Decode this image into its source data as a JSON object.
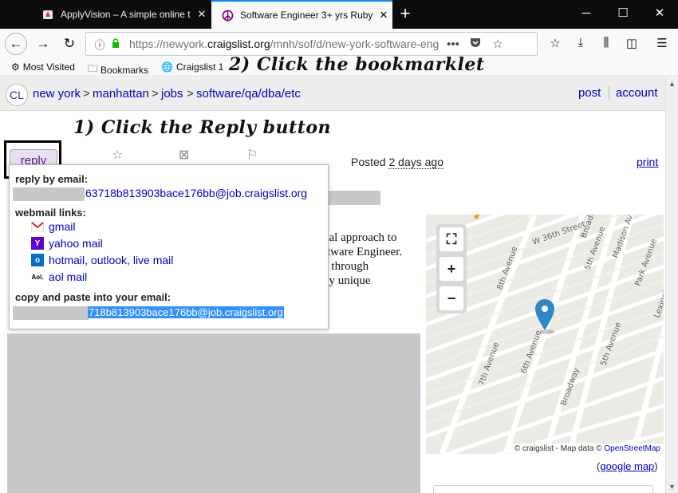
{
  "browser": {
    "tabs": [
      {
        "title": "ApplyVision – A simple online t",
        "icon": "applyvision-icon",
        "active": false
      },
      {
        "title": "Software Engineer 3+ yrs Ruby",
        "icon": "peace-icon",
        "active": true
      }
    ],
    "url_prefix": "https://newyork.",
    "url_domain": "craigslist.org",
    "url_path": "/mnh/sof/d/new-york-software-eng",
    "bookmarks": [
      {
        "label": "Most Visited",
        "icon": "gear-icon"
      },
      {
        "label": "Bookmarks",
        "icon": "folder-icon"
      },
      {
        "label": "Craigslist 1",
        "icon": "globe-icon"
      }
    ]
  },
  "annotations": {
    "step1": "1) Click the Reply button",
    "step2": "2) Click the bookmarklet"
  },
  "breadcrumbs": {
    "logo": "CL",
    "items": [
      "new york",
      "manhattan",
      "jobs",
      "software/qa/dba/etc"
    ],
    "separator": ">",
    "post": "post",
    "account": "account"
  },
  "posting": {
    "reply_label": "reply",
    "posted_prefix": "Posted",
    "posted_ago": "2 days ago",
    "print": "print",
    "body_lines": [
      "nal approach to",
      "ftware Engineer.",
      "e through",
      "by unique"
    ]
  },
  "reply_popup": {
    "reply_by_email_label": "reply by email:",
    "email_visible": "63718b813903bace176bb@job.craigslist.org",
    "webmail_label": "webmail links:",
    "webmail": [
      {
        "label": "gmail",
        "icon": "gmail-icon"
      },
      {
        "label": "yahoo mail",
        "icon": "yahoo-icon"
      },
      {
        "label": "hotmail, outlook, live mail",
        "icon": "outlook-icon"
      },
      {
        "label": "aol mail",
        "icon": "aol-icon"
      }
    ],
    "copy_label": "copy and paste into your email:",
    "copy_email_selected": "718b813903bace176bb@job.craigslist.org"
  },
  "map": {
    "streets": [
      "W 36th Street",
      "Broadway",
      "8th Avenue",
      "5th Avenue",
      "Madison Avenue",
      "Park Avenue",
      "Lexington Ave",
      "7th Avenue",
      "6th Avenue",
      "Broadway"
    ],
    "attribution_prefix": "© craigslist - Map data ©",
    "attribution_link": "OpenStreetMap",
    "google_map_open": "(",
    "google_map": "google map",
    "google_map_close": ")"
  },
  "colors": {
    "link": "#0000cc",
    "visited": "#551a8b",
    "selection": "#3390ff",
    "pin": "#2c87c9"
  }
}
